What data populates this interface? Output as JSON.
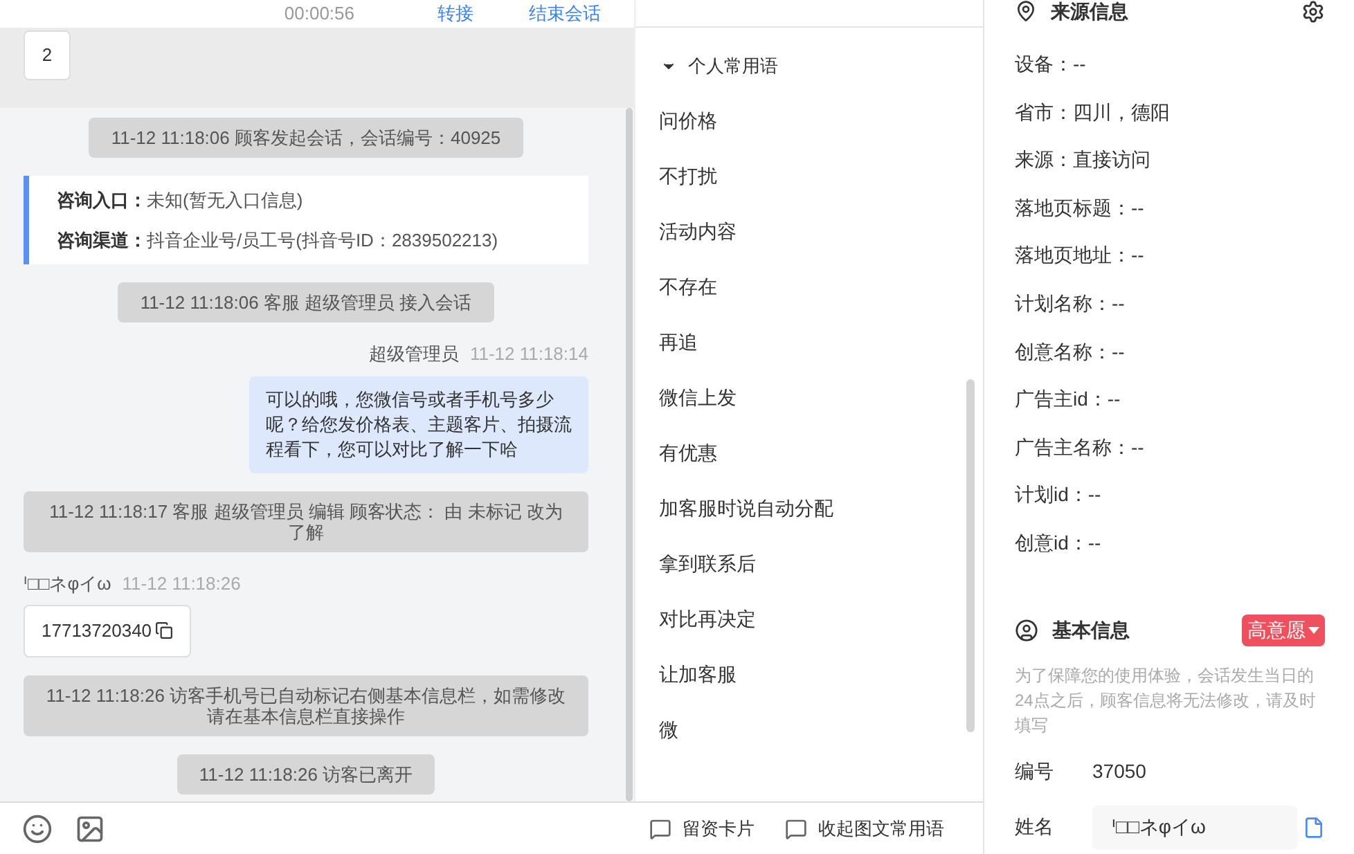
{
  "header": {
    "timer": "00:00:56",
    "actions": [
      "转接",
      "结束会话"
    ]
  },
  "chat": {
    "pinned": "2",
    "messages": [
      {
        "kind": "system",
        "text": "11-12 11:18:06 顾客发起会话，会话编号：40925"
      },
      {
        "kind": "entry_card",
        "rows": [
          {
            "label": "咨询入口：",
            "value": "未知(暂无入口信息)"
          },
          {
            "label": "咨询渠道：",
            "value": "抖音企业号/员工号(抖音号ID：2839502213)"
          }
        ]
      },
      {
        "kind": "system",
        "text": "11-12 11:18:06 客服 超级管理员 接入会话"
      },
      {
        "kind": "agent",
        "sender": "超级管理员",
        "time": "11-12 11:18:14",
        "text": "可以的哦，您微信号或者手机号多少呢？给您发价格表、主题客片、拍摄流程看下，您可以对比了解一下哈"
      },
      {
        "kind": "system",
        "text": "11-12 11:18:17 客服 超级管理员 编辑 顾客状态： 由 未标记 改为了解"
      },
      {
        "kind": "visitor",
        "sender": "ᑊ□□ネφイω",
        "time": "11-12 11:18:26",
        "text": "17713720340"
      },
      {
        "kind": "system",
        "text": "11-12 11:18:26 访客手机号已自动标记右侧基本信息栏，如需修改请在基本信息栏直接操作"
      },
      {
        "kind": "system",
        "text": "11-12 11:18:26 访客已离开"
      }
    ]
  },
  "phrases": {
    "group": {
      "label": "个人常用语",
      "expanded": true
    },
    "items": [
      "问价格",
      "不打扰",
      "活动内容",
      "不存在",
      "再追",
      "微信上发",
      "有优惠",
      "加客服时说自动分配",
      "拿到联系后",
      "对比再决定",
      "让加客服",
      "微"
    ]
  },
  "bottom_actions": [
    "留资卡片",
    "收起图文常用语"
  ],
  "source_info": {
    "title": "来源信息",
    "fields": [
      "设备：--",
      "省市：四川，德阳",
      "来源：直接访问",
      "落地页标题：--",
      "落地页地址：--",
      "计划名称：--",
      "创意名称：--",
      "广告主id：--",
      "广告主名称：--",
      "计划id：--",
      "创意id：--"
    ]
  },
  "basic_info": {
    "title": "基本信息",
    "tag": "高意愿",
    "notice": "为了保障您的使用体验，会话发生当日的24点之后，顾客信息将无法修改，请及时填写",
    "fields": [
      {
        "kind": "text",
        "label": "编号",
        "value": "37050"
      },
      {
        "kind": "input",
        "label": "姓名",
        "value": "ᑊ□□ネφイω"
      }
    ]
  }
}
